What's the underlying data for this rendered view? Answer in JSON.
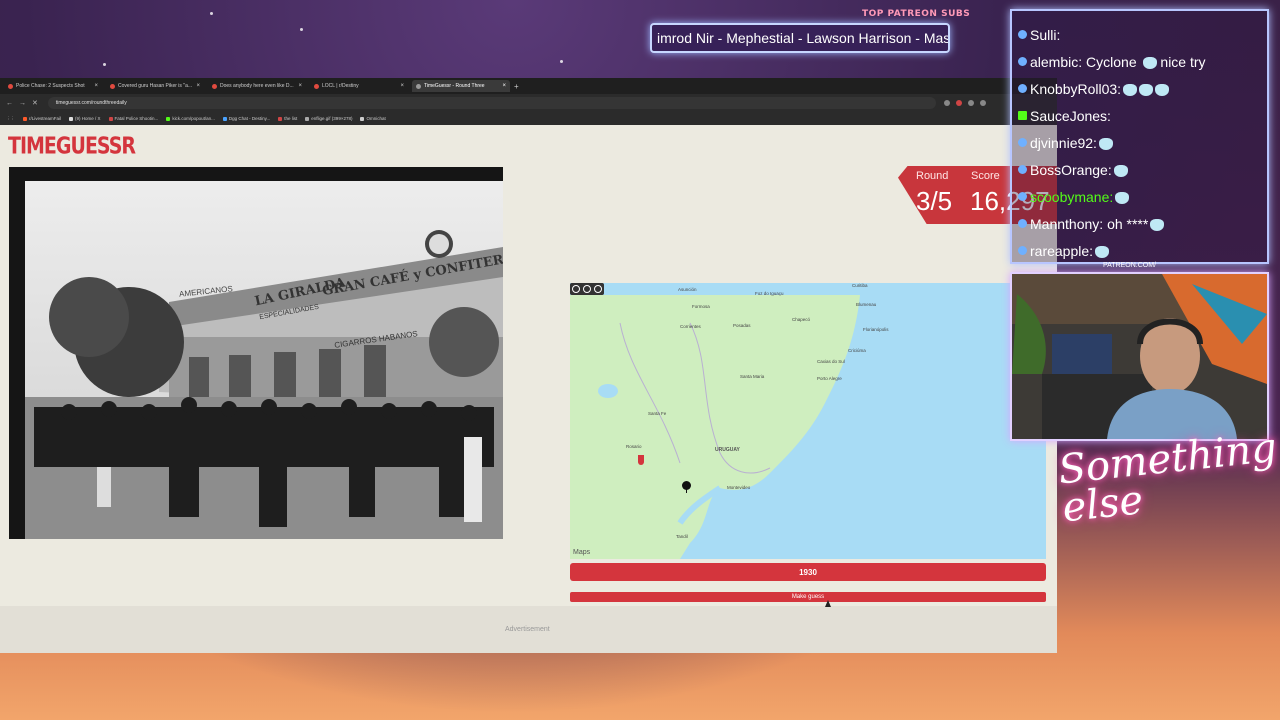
{
  "overlay": {
    "patreon_label": "TOP PATREON SUBS",
    "ticker_text": "imrod Nir - Mephestial - Lawson Harrison - Mas",
    "patreon_url": "PATREON.COM/",
    "brand_text": "Something else",
    "chat": [
      {
        "user": "Sulli:",
        "text": "",
        "badge": "blue"
      },
      {
        "user": "alembic:",
        "text": "Cyclone",
        "extra": "nice try",
        "badge": "blue"
      },
      {
        "user": "KnobbyRoll03:",
        "text": "",
        "badge": "blue"
      },
      {
        "user": "SauceJones:",
        "text": "",
        "badge": "green"
      },
      {
        "user": "djvinnie92:",
        "text": "",
        "badge": "blue"
      },
      {
        "user": "BossOrange:",
        "text": "",
        "badge": "blue"
      },
      {
        "user": "scoobymane:",
        "text": "",
        "badge": "blue"
      },
      {
        "user": "Mannthony:",
        "text": "oh ****",
        "badge": "blue"
      },
      {
        "user": "rareapple:",
        "text": "",
        "badge": "blue"
      }
    ]
  },
  "browser": {
    "tabs": [
      {
        "label": "Police Chase: 2 Suspects Shot",
        "active": false
      },
      {
        "label": "Covered guru Hasan Piker is \"a...",
        "active": false
      },
      {
        "label": "Does anybody here even like D...",
        "active": false
      },
      {
        "label": "LOCL | r/Destiny",
        "active": false
      },
      {
        "label": "TimeGuessr - Round Three",
        "active": true
      }
    ],
    "new_tab": "+",
    "url": "timeguessr.com/roundthreedaily",
    "bookmarks": [
      "r/LivestreamFail",
      "(9) Home / X",
      "Fatal Police Shootin...",
      "kick.com/popout/an...",
      "Dgg Chat - Destiny...",
      "the list",
      "enflige.gif (399×278)",
      "Omnichat"
    ]
  },
  "game": {
    "logo": "TIMEGUESSR",
    "round_label": "Round",
    "score_label": "Score",
    "round_value": "3/5",
    "score_value": "16,297",
    "year_value": "1930",
    "year_fraction": 0.15,
    "guess_button": "Make guess",
    "ad_label": "Advertisement",
    "map_brand": "Maps",
    "map_labels": [
      "Asunción",
      "Curitiba",
      "Foz do Iguaçu",
      "Formosa",
      "Blumenau",
      "Chapecó",
      "Florianópolis",
      "Corrientes",
      "Posadas",
      "Criciúma",
      "Caxias do Sul",
      "Santa Maria",
      "Porto Alegre",
      "Santa Fe",
      "Rosario",
      "URUGUAY",
      "Montevideo",
      "Tandil"
    ],
    "photo_signs": [
      "LA GIRALDA",
      "GRAN CAFÉ y CONFITERÍA",
      "AMERICANOS",
      "CIGARROS HABANOS",
      "ESPECIALIDADES"
    ]
  }
}
